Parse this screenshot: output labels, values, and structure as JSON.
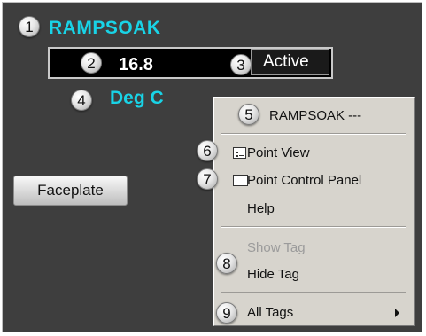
{
  "point": {
    "tag_name": "RAMPSOAK",
    "value": "16.8",
    "status": "Active",
    "units": "Deg C"
  },
  "faceplate_button": {
    "label": "Faceplate"
  },
  "context_menu": {
    "header": "RAMPSOAK ---",
    "items": {
      "point_view": "Point View",
      "point_control_panel": "Point Control Panel",
      "help": "Help",
      "show_tag": "Show Tag",
      "hide_tag": "Hide Tag",
      "all_tags": "All Tags"
    }
  },
  "callouts": [
    "1",
    "2",
    "3",
    "4",
    "5",
    "6",
    "7",
    "8",
    "9"
  ],
  "colors": {
    "panel_background": "#3e3e3e",
    "tag_text": "#19d3e6",
    "menu_background": "#d7d4cd",
    "disabled_text": "#9b9b9b"
  }
}
